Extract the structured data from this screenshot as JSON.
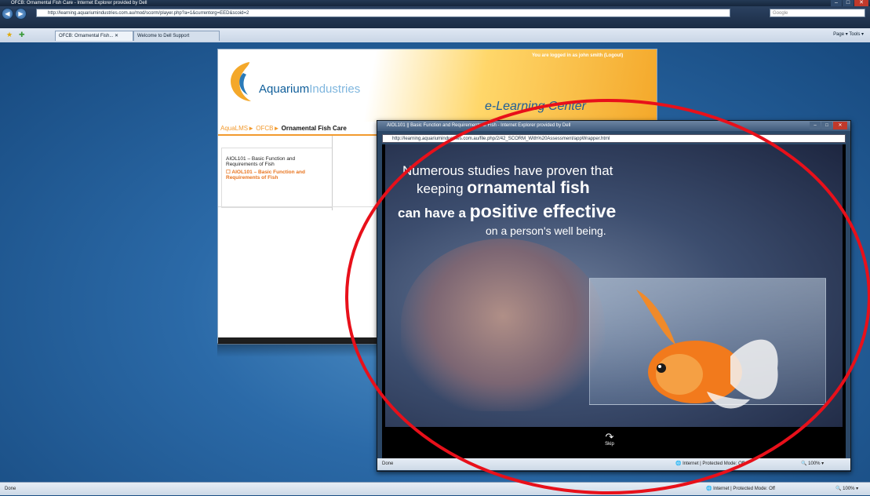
{
  "browser": {
    "window_title": "OFCB: Ornamental Fish Care - Internet Explorer provided by Dell",
    "url": "http://learning.aquariumindustries.com.au/mod/scorm/player.php?a=1&currentorg=EED&scoid=2",
    "search_placeholder": "Google",
    "tabs": [
      {
        "label": "OFCB: Ornamental Fish... ✕"
      },
      {
        "label": "Welcome to Dell Support"
      }
    ],
    "tools": "Page ▾  Tools ▾",
    "status_left": "Done",
    "status_zone": "Internet | Protected Mode: Off",
    "zoom": "100%"
  },
  "lms": {
    "logged_in": "You are logged in as john smith (Logout)",
    "logo_word1": "Aquarium",
    "logo_word2": "Industries",
    "center_title": "e-Learning Center",
    "breadcrumbs": [
      "AquaLMS",
      "OFCB",
      "Ornamental Fish Care"
    ],
    "course_title": "AIOL101 – Basic Function and Requirements of Fish",
    "course_link": "AIOL101 – Basic Function and Requirements of Fish"
  },
  "popup": {
    "title": "AIOL101 || Basic Function and Requirements of Fish - Internet Explorer provided by Dell",
    "url": "http://learning.aquariumindustries.com.au/file.php/2/42_SCORM_With%20Assessment/appWrapper.html",
    "slide": {
      "line1": "Numerous studies have proven that",
      "line2_a": "keeping ",
      "line2_b": "ornamental fish",
      "line3_a": "can have a ",
      "line3_b": "positive effective",
      "line4": "on a person's well being."
    },
    "skip_label": "Skip",
    "status_left": "Done",
    "status_zone": "Internet | Protected Mode: Off",
    "zoom": "100%"
  },
  "annotation": {
    "color": "#e8101a"
  }
}
